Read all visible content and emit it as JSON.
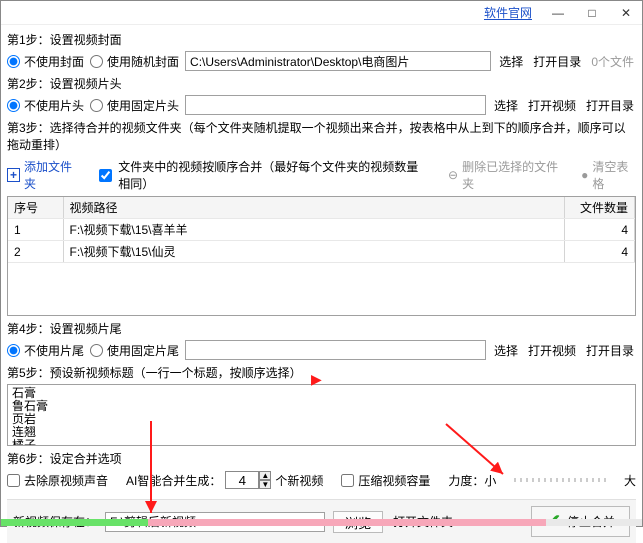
{
  "titlebar": {
    "link": "软件官网",
    "min": "—",
    "max": "□",
    "close": "✕"
  },
  "step1": {
    "label": "第1步：设置视频封面",
    "opt_none": "不使用封面",
    "opt_rand": "使用随机封面",
    "path": "C:\\Users\\Administrator\\Desktop\\电商图片",
    "btn_select": "选择",
    "btn_open": "打开目录",
    "filecount": "0个文件"
  },
  "step2": {
    "label": "第2步：设置视频片头",
    "opt_none": "不使用片头",
    "opt_fixed": "使用固定片头",
    "path": "",
    "btn_select": "选择",
    "btn_open_vid": "打开视频",
    "btn_open_dir": "打开目录"
  },
  "step3": {
    "label": "第3步：选择待合并的视频文件夹（每个文件夹随机提取一个视频出来合并，按表格中从上到下的顺序合并，顺序可以拖动重排）",
    "add": "添加文件夹",
    "chk_order": "文件夹中的视频按顺序合并（最好每个文件夹的视频数量相同）",
    "del_sel": "删除已选择的文件夹",
    "clear": "清空表格",
    "cols": {
      "idx": "序号",
      "path": "视频路径",
      "count": "文件数量"
    },
    "rows": [
      {
        "idx": "1",
        "path": "F:\\视频下载\\15\\喜羊羊",
        "count": "4"
      },
      {
        "idx": "2",
        "path": "F:\\视频下载\\15\\仙灵",
        "count": "4"
      }
    ]
  },
  "step4": {
    "label": "第4步：设置视频片尾",
    "opt_none": "不使用片尾",
    "opt_fixed": "使用固定片尾",
    "path": "",
    "btn_select": "选择",
    "btn_open_vid": "打开视频",
    "btn_open_dir": "打开目录"
  },
  "step5": {
    "label": "第5步：预设新视频标题（一行一个标题，按顺序选择）",
    "titles": "石膏\n鲁石膏\n页岩\n连翘\n橘子"
  },
  "step6": {
    "label": "第6步：设定合并选项",
    "chk_remove_audio": "去除原视频声音",
    "ai_label_a": "AI智能合并生成：",
    "ai_value": "4",
    "ai_label_b": "个新视频",
    "chk_compress": "压缩视频容量",
    "strength_label": "力度：",
    "strength_min": "小",
    "strength_max": "大"
  },
  "bottom": {
    "save_label": "新视频保存在：",
    "save_path": "F:\\剪辑后新视频",
    "browse": "浏览",
    "open_folder": "打开文件夹",
    "stop": "停止合并"
  },
  "progress": {
    "green_pct": 23,
    "pink_pct": 62,
    "gray_pct": 15
  }
}
